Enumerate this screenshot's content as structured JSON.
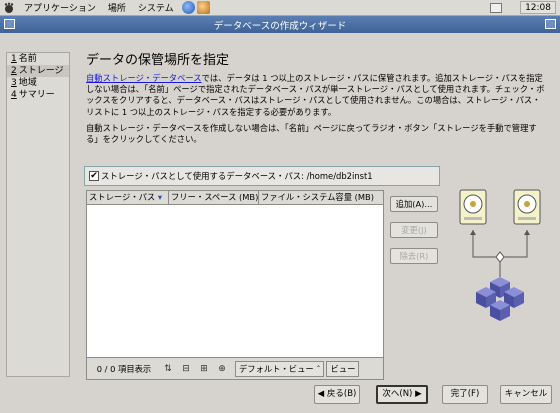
{
  "panel": {
    "menus": [
      "アプリケーション",
      "場所",
      "システム"
    ],
    "clock": "12:08"
  },
  "window": {
    "title": "データベースの作成ウィザード"
  },
  "sidebar": {
    "items": [
      {
        "num": "1",
        "label": "名前"
      },
      {
        "num": "2",
        "label": "ストレージ"
      },
      {
        "num": "3",
        "label": "地域"
      },
      {
        "num": "4",
        "label": "サマリー"
      }
    ]
  },
  "main": {
    "heading": "データの保管場所を指定",
    "para1_link": "自動ストレージ・データベース",
    "para1_rest": "では、データは 1 つ以上のストレージ・パスに保管されます。追加ストレージ・パスを指定しない場合は、「名前」ページで指定されたデータベース・パスが単一ストレージ・パスとして使用されます。チェック・ボックスをクリアすると、データベース・パスはストレージ・パスとして使用されません。この場合は、ストレージ・パス・リストに 1 つ以上のストレージ・パスを指定する必要があります。",
    "para2": "自動ストレージ・データベースを作成しない場合は、「名前」ページに戻ってラジオ・ボタン「ストレージを手動で管理する」をクリックしてください。",
    "checkbox_label": "ストレージ・パスとして使用するデータベース・パス: /home/db2inst1",
    "checkbox_checked": true,
    "table": {
      "columns": [
        "ストレージ・パス",
        "フリー・スペース (MB)",
        "ファイル・システム容量 (MB)"
      ],
      "rows": [],
      "count_label": "0 / 0 項目表示",
      "view_label": "デフォルト・ビュー",
      "view2_label": "ビュー"
    },
    "buttons": {
      "add": "追加(A)...",
      "change": "変更(J)",
      "remove": "除去(R)"
    }
  },
  "footer": {
    "back": "◀ 戻る(B)",
    "next": "次へ(N) ▶",
    "finish": "完了(F)",
    "cancel": "キャンセル"
  },
  "colors": {
    "titlebar": "#4a6fa5",
    "link": "#1a1ad8",
    "highlight_frame": "#85a6a8",
    "cube": "#5a5fb0"
  }
}
